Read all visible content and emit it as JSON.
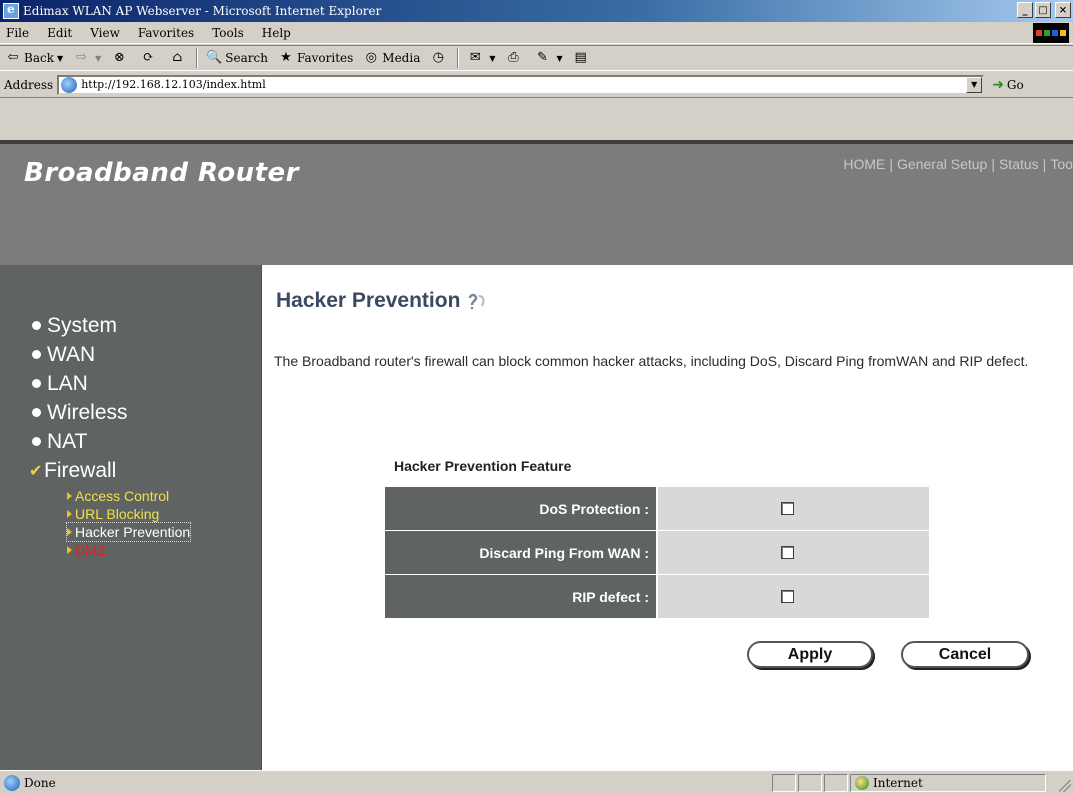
{
  "window": {
    "title": "Edimax WLAN AP Webserver - Microsoft Internet Explorer",
    "minimize": "_",
    "maximize": "□",
    "close": "×"
  },
  "menu": [
    "File",
    "Edit",
    "View",
    "Favorites",
    "Tools",
    "Help"
  ],
  "toolbar": {
    "back": "Back",
    "search": "Search",
    "favorites": "Favorites",
    "media": "Media"
  },
  "address": {
    "label": "Address",
    "url": "http://192.168.12.103/index.html",
    "go": "Go"
  },
  "header": {
    "brand": "Broadband Router",
    "nav": [
      "HOME",
      "General Setup",
      "Status",
      "Tool"
    ]
  },
  "sidebar": {
    "items": [
      {
        "label": "System",
        "icon": "bullet"
      },
      {
        "label": "WAN",
        "icon": "bullet"
      },
      {
        "label": "LAN",
        "icon": "bullet"
      },
      {
        "label": "Wireless",
        "icon": "bullet"
      },
      {
        "label": "NAT",
        "icon": "bullet"
      },
      {
        "label": "Firewall",
        "icon": "checkmark",
        "expanded": true
      }
    ],
    "subitems": [
      {
        "label": "Access Control"
      },
      {
        "label": "URL Blocking"
      },
      {
        "label": "Hacker Prevention",
        "current": true
      },
      {
        "label": "DMZ"
      }
    ]
  },
  "main": {
    "title": "Hacker Prevention",
    "description": "The Broadband router's firewall can block common hacker attacks, including DoS, Discard Ping fromWAN and RIP defect.",
    "feature_title": "Hacker Prevention Feature",
    "rows": [
      {
        "label": "DoS Protection :",
        "checked": false
      },
      {
        "label": "Discard Ping From WAN :",
        "checked": false
      },
      {
        "label": "RIP defect :",
        "checked": false
      }
    ],
    "apply": "Apply",
    "cancel": "Cancel"
  },
  "status": {
    "text": "Done",
    "zone": "Internet"
  },
  "colors": {
    "header_bg": "#7c7c7c",
    "sidebar_bg": "#5f6361",
    "title_color": "#3a4a63",
    "submenu_color": "#f0e24a",
    "dmz_color": "#e02020"
  }
}
